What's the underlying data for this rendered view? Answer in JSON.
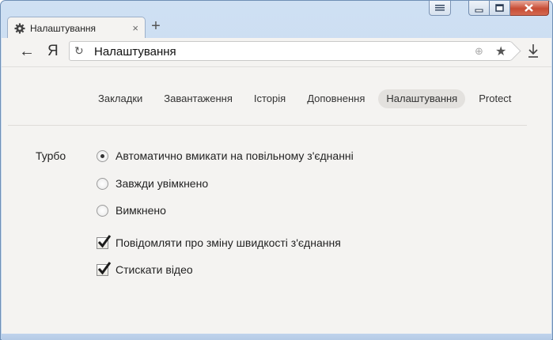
{
  "window": {
    "extra_button_icon": "menu-lines-icon",
    "minimize_icon": "minimize-icon",
    "maximize_icon": "maximize-icon",
    "close_icon": "close-icon"
  },
  "tab": {
    "title": "Налаштування",
    "favicon": "gear-icon",
    "close_glyph": "×",
    "new_tab_glyph": "+"
  },
  "toolbar": {
    "back_glyph": "←",
    "yandex_logo": "Я",
    "reload_glyph": "↻",
    "address": "Налаштування",
    "globe_glyph": "⊕",
    "star_glyph": "★",
    "download_icon": "download-icon"
  },
  "nav": {
    "items": [
      {
        "label": "Закладки"
      },
      {
        "label": "Завантаження"
      },
      {
        "label": "Історія"
      },
      {
        "label": "Доповнення"
      },
      {
        "label": "Налаштування",
        "active": true
      },
      {
        "label": "Protect"
      }
    ]
  },
  "turbo": {
    "label": "Турбо",
    "radios": [
      {
        "label": "Автоматично вмикати на повільному з'єднанні",
        "checked": true
      },
      {
        "label": "Завжди увімкнено",
        "checked": false
      },
      {
        "label": "Вимкнено",
        "checked": false
      }
    ],
    "checkboxes": [
      {
        "label": "Повідомляти про зміну швидкості з'єднання",
        "checked": true
      },
      {
        "label": "Стискати відео",
        "checked": true
      }
    ]
  }
}
